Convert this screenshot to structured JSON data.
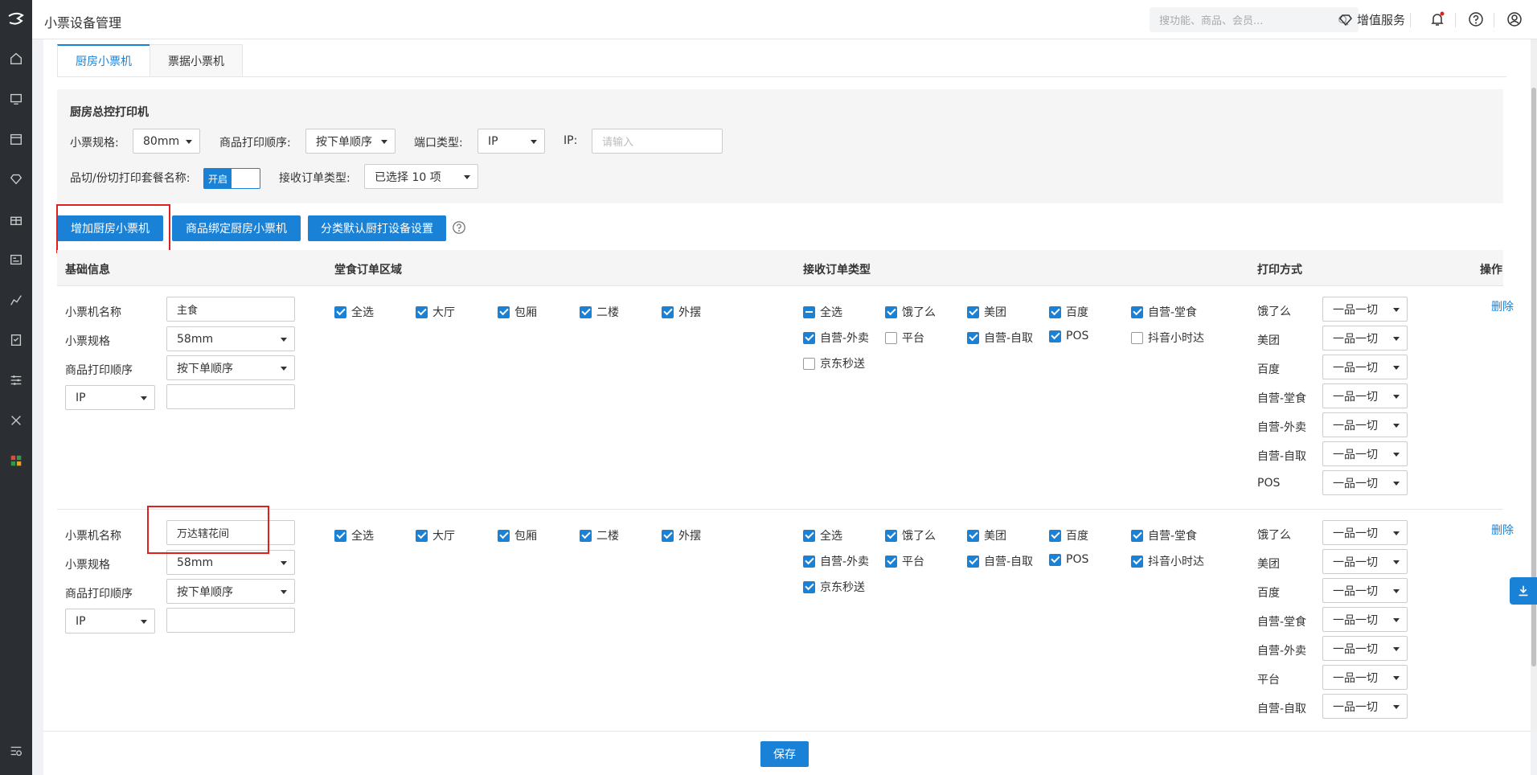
{
  "page": {
    "title": "小票设备管理"
  },
  "header": {
    "search_placeholder": "搜功能、商品、会员...",
    "vas_label": "增值服务"
  },
  "tabs": [
    {
      "label": "厨房小票机",
      "active": true
    },
    {
      "label": "票据小票机",
      "active": false
    }
  ],
  "master_printer": {
    "title": "厨房总控打印机",
    "size_label": "小票规格:",
    "size_value": "80mm",
    "order_label": "商品打印顺序:",
    "order_value": "按下单顺序",
    "port_label": "端口类型:",
    "port_value": "IP",
    "ip_label": "IP:",
    "ip_placeholder": "请输入",
    "combo_label": "品切/份切打印套餐名称:",
    "combo_toggle": "开启",
    "order_type_label": "接收订单类型:",
    "order_type_value": "已选择 10 项"
  },
  "actions": {
    "add": "增加厨房小票机",
    "bind": "商品绑定厨房小票机",
    "category": "分类默认厨打设备设置"
  },
  "table_headers": {
    "basic": "基础信息",
    "dine_area": "堂食订单区域",
    "order_types": "接收订单类型",
    "print_mode": "打印方式",
    "ops": "操作"
  },
  "field_labels": {
    "name": "小票机名称",
    "size": "小票规格",
    "order": "商品打印顺序"
  },
  "printers": [
    {
      "name": "主食",
      "size": "58mm",
      "order": "按下单顺序",
      "port": "IP",
      "ip": "",
      "areas": [
        {
          "label": "全选",
          "checked": true
        },
        {
          "label": "大厅",
          "checked": true
        },
        {
          "label": "包厢",
          "checked": true
        },
        {
          "label": "二楼",
          "checked": true
        },
        {
          "label": "外摆",
          "checked": true
        }
      ],
      "types": [
        {
          "label": "全选",
          "state": "indeterminate"
        },
        {
          "label": "饿了么",
          "state": "checked"
        },
        {
          "label": "美团",
          "state": "checked"
        },
        {
          "label": "百度",
          "state": "checked"
        },
        {
          "label": "自营-堂食",
          "state": "checked"
        },
        {
          "label": "自营-外卖",
          "state": "checked"
        },
        {
          "label": "平台",
          "state": "unchecked"
        },
        {
          "label": "自营-自取",
          "state": "checked"
        },
        {
          "label": "POS",
          "state": "checked"
        },
        {
          "label": "抖音小时达",
          "state": "unchecked"
        },
        {
          "label": "京东秒送",
          "state": "unchecked"
        }
      ],
      "print_modes": [
        {
          "label": "饿了么",
          "value": "一品一切"
        },
        {
          "label": "美团",
          "value": "一品一切"
        },
        {
          "label": "百度",
          "value": "一品一切"
        },
        {
          "label": "自营-堂食",
          "value": "一品一切"
        },
        {
          "label": "自营-外卖",
          "value": "一品一切"
        },
        {
          "label": "自营-自取",
          "value": "一品一切"
        },
        {
          "label": "POS",
          "value": "一品一切"
        }
      ],
      "delete": "删除"
    },
    {
      "name": "万达辖花间",
      "size": "58mm",
      "order": "按下单顺序",
      "port": "IP",
      "ip": "",
      "areas": [
        {
          "label": "全选",
          "checked": true
        },
        {
          "label": "大厅",
          "checked": true
        },
        {
          "label": "包厢",
          "checked": true
        },
        {
          "label": "二楼",
          "checked": true
        },
        {
          "label": "外摆",
          "checked": true
        }
      ],
      "types": [
        {
          "label": "全选",
          "state": "checked"
        },
        {
          "label": "饿了么",
          "state": "checked"
        },
        {
          "label": "美团",
          "state": "checked"
        },
        {
          "label": "百度",
          "state": "checked"
        },
        {
          "label": "自营-堂食",
          "state": "checked"
        },
        {
          "label": "自营-外卖",
          "state": "checked"
        },
        {
          "label": "平台",
          "state": "checked"
        },
        {
          "label": "自营-自取",
          "state": "checked"
        },
        {
          "label": "POS",
          "state": "checked"
        },
        {
          "label": "抖音小时达",
          "state": "checked"
        },
        {
          "label": "京东秒送",
          "state": "checked"
        }
      ],
      "print_modes": [
        {
          "label": "饿了么",
          "value": "一品一切"
        },
        {
          "label": "美团",
          "value": "一品一切"
        },
        {
          "label": "百度",
          "value": "一品一切"
        },
        {
          "label": "自营-堂食",
          "value": "一品一切"
        },
        {
          "label": "自营-外卖",
          "value": "一品一切"
        },
        {
          "label": "平台",
          "value": "一品一切"
        },
        {
          "label": "自营-自取",
          "value": "一品一切"
        }
      ],
      "delete": "删除"
    }
  ],
  "footer": {
    "save": "保存"
  }
}
